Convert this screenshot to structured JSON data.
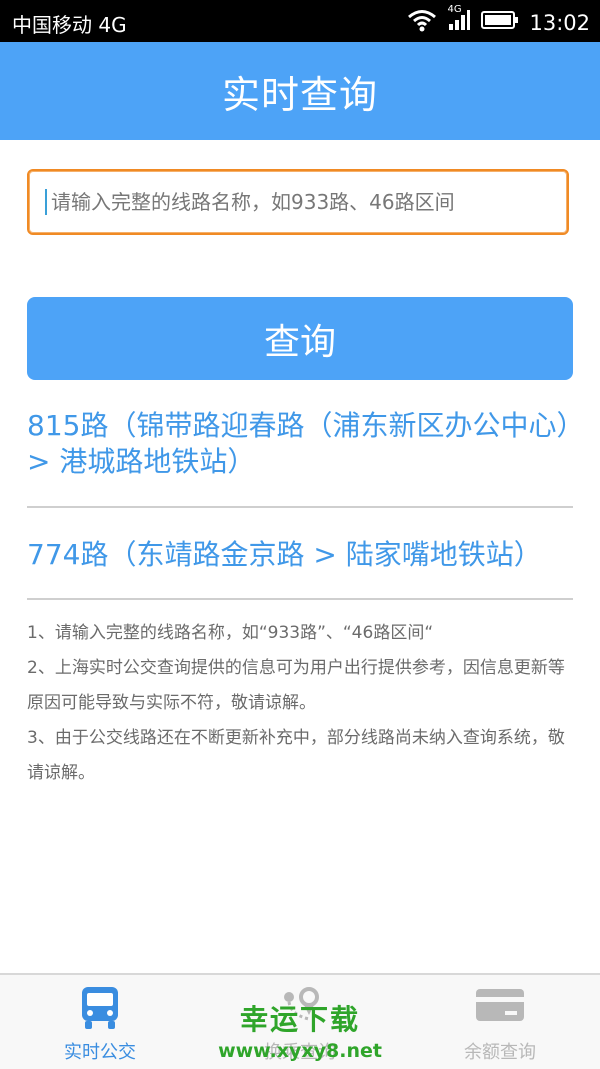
{
  "status_bar": {
    "carrier": "中国移动 4G",
    "network_badge": "4G",
    "time": "13:02",
    "icons": [
      "wifi-icon",
      "signal-icon",
      "battery-icon"
    ]
  },
  "header": {
    "title": "实时查询"
  },
  "search": {
    "placeholder": "请输入完整的线路名称，如933路、46路区间",
    "value": ""
  },
  "query_button": {
    "label": "查询"
  },
  "routes": [
    {
      "text": "815路（锦带路迎春路（浦东新区办公中心）> 港城路地铁站）"
    },
    {
      "text": "774路（东靖路金京路 > 陆家嘴地铁站）"
    }
  ],
  "notes": [
    "1、请输入完整的线路名称，如“933路”、“46路区间“",
    "2、上海实时公交查询提供的信息可为用户出行提供参考，因信息更新等原因可能导致与实际不符，敬请谅解。",
    "3、由于公交线路还在不断更新补充中，部分线路尚未纳入查询系统，敬请谅解。"
  ],
  "tabs": [
    {
      "label": "实时公交",
      "icon": "bus-icon",
      "active": true
    },
    {
      "label": "换乘查询",
      "icon": "map-pin-icon",
      "active": false
    },
    {
      "label": "余额查询",
      "icon": "card-icon",
      "active": false
    }
  ],
  "watermark": {
    "title": "幸运下载",
    "url": "www.xyxy8.net"
  },
  "colors": {
    "primary": "#4da3f7",
    "route_link": "#4098e8",
    "focus_border": "#f08a24",
    "watermark": "#2fa52a"
  }
}
